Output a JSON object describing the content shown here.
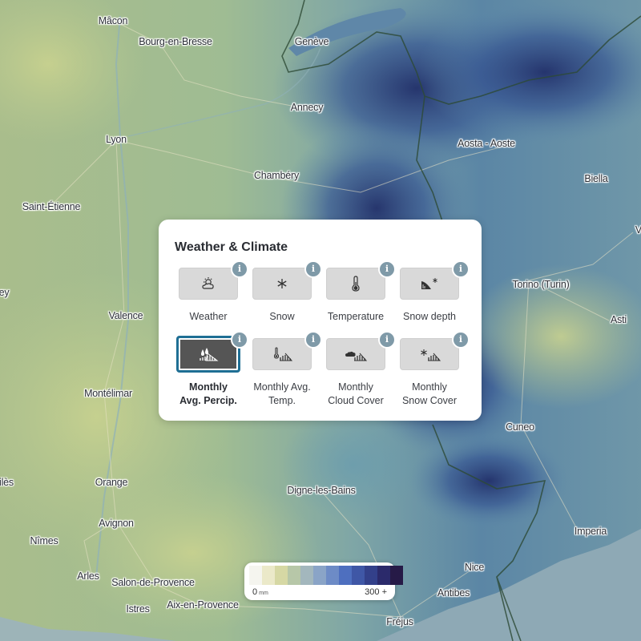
{
  "panel": {
    "title": "Weather & Climate",
    "layers": [
      {
        "label": "Weather",
        "icon": "sun-cloud-icon",
        "active": false
      },
      {
        "label": "Snow",
        "icon": "snowflake-icon",
        "active": false
      },
      {
        "label": "Temperature",
        "icon": "thermometer-icon",
        "active": false
      },
      {
        "label": "Snow depth",
        "icon": "snow-depth-icon",
        "active": false
      },
      {
        "label": "Monthly Avg. Percip.",
        "icon": "precipitation-chart-icon",
        "active": true
      },
      {
        "label": "Monthly Avg. Temp.",
        "icon": "temperature-chart-icon",
        "active": false
      },
      {
        "label": "Monthly Cloud Cover",
        "icon": "cloud-chart-icon",
        "active": false
      },
      {
        "label": "Monthly Snow Cover",
        "icon": "snow-chart-icon",
        "active": false
      }
    ]
  },
  "legend": {
    "min": "0",
    "unit": "mm",
    "max": "300 +",
    "colors": [
      "#f5f5ef",
      "#ebe9c9",
      "#d6d8a4",
      "#b7c7a8",
      "#a3b7bd",
      "#8aa4c7",
      "#6d8bc6",
      "#4e6fbf",
      "#3f57a6",
      "#33408a",
      "#2b2a6b",
      "#261a47"
    ]
  },
  "cities": [
    {
      "name": "Mâcon"
    },
    {
      "name": "Bourg-en-Bresse"
    },
    {
      "name": "Genève"
    },
    {
      "name": "Annecy"
    },
    {
      "name": "Lyon"
    },
    {
      "name": "Aosta - Aoste"
    },
    {
      "name": "Chambéry"
    },
    {
      "name": "Biella"
    },
    {
      "name": "Saint-Étienne"
    },
    {
      "name": "Torino (Turin)"
    },
    {
      "name": "ey"
    },
    {
      "name": "Valence"
    },
    {
      "name": "Asti"
    },
    {
      "name": "Montélimar"
    },
    {
      "name": "Cuneo"
    },
    {
      "name": "Orange"
    },
    {
      "name": "Digne-les-Bains"
    },
    {
      "name": "Avignon"
    },
    {
      "name": "Nîmes"
    },
    {
      "name": "Imperia"
    },
    {
      "name": "Arles"
    },
    {
      "name": "Nice"
    },
    {
      "name": "Salon-de-Provence"
    },
    {
      "name": "Aix-en-Provence"
    },
    {
      "name": "Antibes"
    },
    {
      "name": "Istres"
    },
    {
      "name": "Fréjus"
    },
    {
      "name": "ilès"
    },
    {
      "name": "V"
    }
  ]
}
